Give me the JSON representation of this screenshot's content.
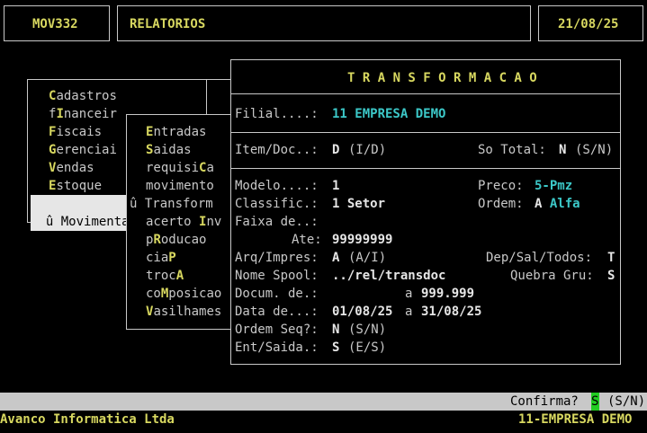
{
  "header": {
    "program_code": "MOV332",
    "section": "RELATORIOS",
    "date": "21/08/25"
  },
  "main_menu": {
    "items": [
      {
        "pre": "",
        "key": "C",
        "post": "adastros"
      },
      {
        "pre": "f",
        "key": "I",
        "post": "nanceir"
      },
      {
        "pre": "",
        "key": "F",
        "post": "iscais"
      },
      {
        "pre": "",
        "key": "G",
        "post": "erenciai"
      },
      {
        "pre": "",
        "key": "V",
        "post": "endas"
      },
      {
        "pre": "",
        "key": "E",
        "post": "stoque"
      }
    ],
    "selected_marker": "û",
    "selected_label": "Movimenta"
  },
  "sub_menu": {
    "items": [
      {
        "pre": "",
        "key": "E",
        "post": "ntradas"
      },
      {
        "pre": "",
        "key": "S",
        "post": "aidas"
      },
      {
        "pre": "requisi",
        "key": "C",
        "post": "a"
      },
      {
        "pre": "movimento",
        "key": "",
        "post": ""
      },
      {
        "pre": "",
        "key": "",
        "post": "Transform"
      },
      {
        "pre": "acerto ",
        "key": "I",
        "post": "nv"
      },
      {
        "pre": "p",
        "key": "R",
        "post": "oducao"
      },
      {
        "pre": "cia",
        "key": "P",
        "post": ""
      },
      {
        "pre": "troc",
        "key": "A",
        "post": ""
      },
      {
        "pre": "co",
        "key": "M",
        "post": "posicao"
      },
      {
        "pre": "",
        "key": "V",
        "post": "asilhames"
      }
    ],
    "selected_marker": "û"
  },
  "form": {
    "title": "T R A N S F O R M A C A O",
    "filial_label": "Filial....:",
    "filial_value": "11 EMPRESA DEMO",
    "item_doc_label": "Item/Doc..:",
    "item_doc_value": "D",
    "item_doc_hint": "(I/D)",
    "so_total_label": "So Total:",
    "so_total_value": "N",
    "so_total_hint": "(S/N)",
    "modelo_label": "Modelo....:",
    "modelo_value": "1",
    "preco_label": "Preco:",
    "preco_value": "5-Pmz",
    "classific_label": "Classific.:",
    "classific_value": "1 Setor",
    "ordem_label": "Ordem:",
    "ordem_value_key": "A",
    "ordem_value_text": "Alfa",
    "faixa_label": "Faixa de..:",
    "ate_label": "Ate:",
    "ate_value": "99999999",
    "arq_label": "Arq/Impres:",
    "arq_value": "A",
    "arq_hint": "(A/I)",
    "dep_label": "Dep/Sal/Todos:",
    "dep_value": "T",
    "spool_label": "Nome Spool:",
    "spool_value": "../rel/transdoc",
    "quebra_label": "Quebra Gru:",
    "quebra_value": "S",
    "docum_label": "Docum. de.:",
    "docum_a": "a",
    "docum_value": "999.999",
    "data_label": "Data de...:",
    "data_from": "01/08/25",
    "data_a": "a",
    "data_to": "31/08/25",
    "ordem_seq_label": "Ordem Seq?:",
    "ordem_seq_value": "N",
    "ordem_seq_hint": "(S/N)",
    "ent_saida_label": "Ent/Saida.:",
    "ent_saida_value": "S",
    "ent_saida_hint": "(E/S)"
  },
  "confirm": {
    "label": "Confirma?",
    "value": "S",
    "hint": "(S/N)"
  },
  "status": {
    "company": "Avanco Informatica Ltda",
    "branch": "11-EMPRESA DEMO"
  },
  "colors": {
    "accent_yellow": "#d8d860",
    "accent_cyan": "#3cc8c8",
    "confirm_bar": "#c8c8c8",
    "input_green": "#22cc22"
  }
}
